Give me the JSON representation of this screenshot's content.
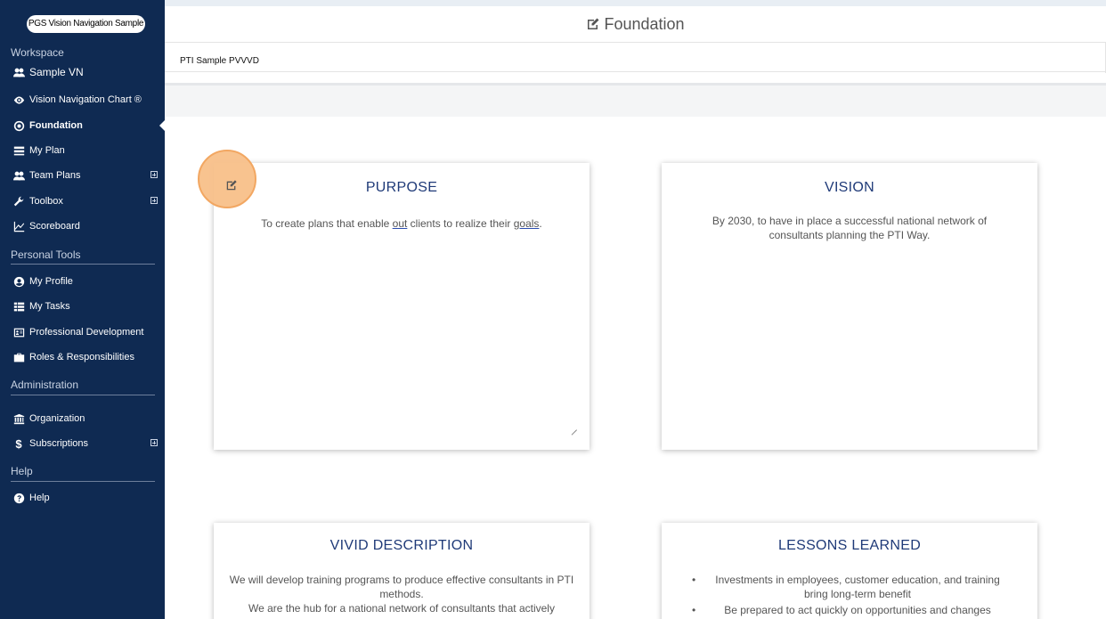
{
  "brand": "PGS Vision Navigation Sample",
  "sidebar": {
    "workspace_label": "Workspace",
    "workspace_name": "Sample VN",
    "items": [
      {
        "label": "Vision Navigation Chart ®"
      },
      {
        "label": "Foundation"
      },
      {
        "label": "My Plan"
      },
      {
        "label": "Team Plans"
      },
      {
        "label": "Toolbox"
      },
      {
        "label": "Scoreboard"
      }
    ],
    "personal_label": "Personal Tools",
    "personal_items": [
      {
        "label": "My Profile"
      },
      {
        "label": "My Tasks"
      },
      {
        "label": "Professional Development"
      },
      {
        "label": "Roles & Responsibilities"
      }
    ],
    "admin_label": "Administration",
    "admin_items": [
      {
        "label": "Organization"
      },
      {
        "label": "Subscriptions"
      }
    ],
    "help_label": "Help",
    "help_items": [
      {
        "label": "Help"
      }
    ]
  },
  "header": {
    "title": "Foundation",
    "subtitle": "PTI Sample PVVVD"
  },
  "cards": {
    "purpose": {
      "title": "PURPOSE",
      "text_before": "To create plans that enable ",
      "word_1": "out",
      "text_middle": " clients to realize their ",
      "word_2": "goals",
      "text_after": "."
    },
    "vision": {
      "title": "VISION",
      "body": "By 2030, to have in place a successful national network of consultants planning the PTI Way."
    },
    "vivid": {
      "title": "VIVID DESCRIPTION",
      "line_1": "We will develop training programs to produce effective consultants in PTI methods.",
      "line_2": "We are the hub for a national network of consultants that actively"
    },
    "lessons": {
      "title": "LESSONS LEARNED",
      "items": [
        "Investments in employees, customer education, and training bring long-term benefit",
        "Be prepared to act quickly on opportunities and changes"
      ]
    }
  },
  "icons": {
    "workspace": "users-icon",
    "edit": "edit-icon"
  },
  "colors": {
    "sidebar_bg": "#0f2a52",
    "card_title": "#1f3a78",
    "highlight": "#f8c08a"
  }
}
